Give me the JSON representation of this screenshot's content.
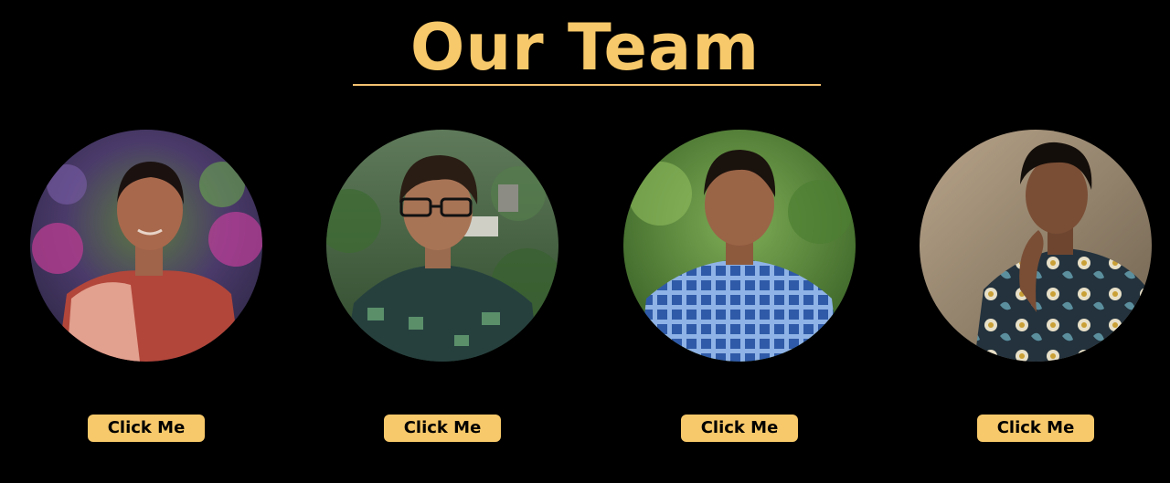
{
  "page": {
    "title": "Our Team"
  },
  "colors": {
    "background": "#000000",
    "accent": "#f8c96a",
    "button_text": "#000000"
  },
  "team": [
    {
      "photo": "portrait-woman-red-saree",
      "button_label": "Click Me"
    },
    {
      "photo": "portrait-man-glasses-forest",
      "button_label": "Click Me"
    },
    {
      "photo": "portrait-man-blue-checked-shirt",
      "button_label": "Click Me"
    },
    {
      "photo": "portrait-man-floral-shirt",
      "button_label": "Click Me"
    }
  ]
}
